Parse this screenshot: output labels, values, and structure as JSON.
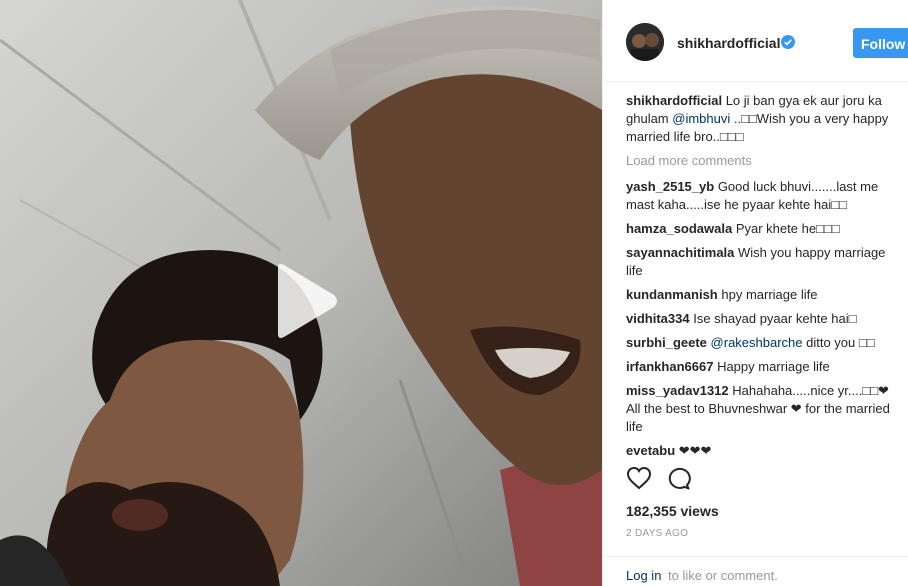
{
  "post": {
    "username": "shikhardofficial",
    "follow_label": "Follow",
    "caption_user": "shikhardofficial",
    "caption_pre": "Lo ji ban gya ek aur joru ka ghulam ",
    "caption_mention": "@imbhuvi",
    "caption_post": " ..□□Wish you a very happy married life bro..□□□",
    "load_more": "Load more comments",
    "comments": [
      {
        "user": "yash_2515_yb",
        "text": "Good luck bhuvi.......last me mast kaha.....ise he pyaar kehte hai□□"
      },
      {
        "user": "hamza_sodawala",
        "text": "Pyar khete he□□□"
      },
      {
        "user": "sayannachitimala",
        "text": "Wish you happy marriage life"
      },
      {
        "user": "kundanmanish",
        "text": "hpy marriage life"
      },
      {
        "user": "vidhita334",
        "text": "Ise shayad pyaar kehte hai□"
      },
      {
        "user": "surbhi_geete",
        "mention": "@rakeshbarche",
        "text": " ditto you □□"
      },
      {
        "user": "irfankhan6667",
        "text": "Happy marriage life"
      },
      {
        "user": "miss_yadav1312",
        "text": "Hahahaha.....nice yr....□□❤ All the best to Bhuvneshwar ❤ for the married life"
      },
      {
        "user": "evetabu",
        "text": "❤❤❤"
      }
    ],
    "views": "182,355 views",
    "date": "2 DAYS AGO",
    "footer_login": "Log in",
    "footer_rest": "to like or comment."
  },
  "icons": {
    "play": "play-icon",
    "heart": "heart-icon",
    "comment": "comment-icon",
    "verified": "verified-badge-icon"
  },
  "colors": {
    "follow_button": "#3897f0",
    "verified_badge": "#3897f0",
    "muted_text": "#999999",
    "link_text": "#003569"
  }
}
